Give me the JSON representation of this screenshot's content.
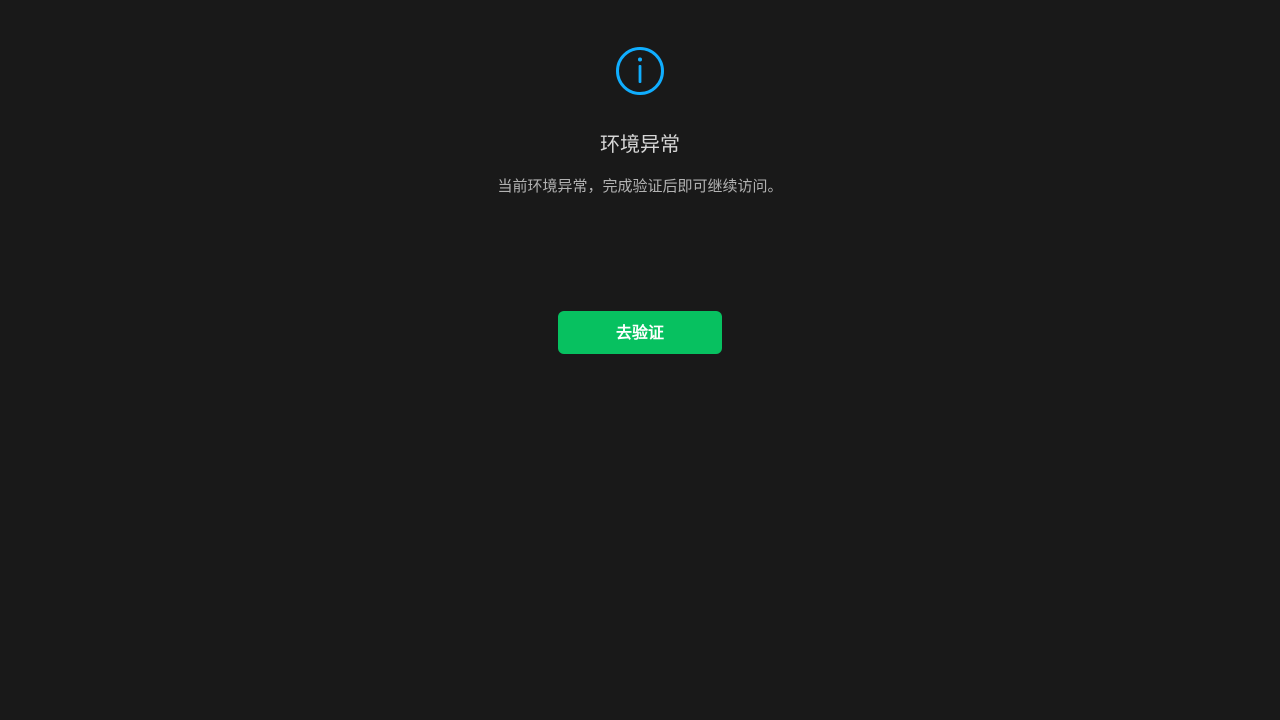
{
  "notice": {
    "icon": "info-circle-icon",
    "icon_color": "#10aeff",
    "title": "环境异常",
    "description": "当前环境异常，完成验证后即可继续访问。"
  },
  "actions": {
    "verify_label": "去验证",
    "verify_color": "#07c160"
  },
  "theme": {
    "background": "#191919"
  }
}
